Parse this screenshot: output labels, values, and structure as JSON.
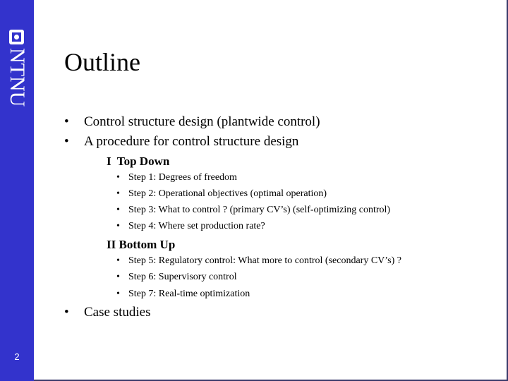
{
  "sidebar": {
    "logo_text": "NTNU",
    "page_number": "2",
    "color": "#3333cc"
  },
  "slide": {
    "title": "Outline",
    "bullet_glyph": "•",
    "items": [
      {
        "text": "Control structure design (plantwide control)"
      },
      {
        "text": "A procedure for control structure design"
      }
    ],
    "sections": [
      {
        "heading": "I  Top Down",
        "steps": [
          "Step 1: Degrees of freedom",
          "Step 2: Operational objectives (optimal operation)",
          "Step 3: What to control ? (primary CV’s) (self-optimizing control)",
          "Step 4: Where set production rate?"
        ]
      },
      {
        "heading": "II Bottom Up",
        "steps": [
          "Step 5: Regulatory control: What more to control (secondary CV’s) ?",
          "Step 6: Supervisory control",
          "Step 7: Real-time optimization"
        ]
      }
    ],
    "final_item": "Case studies"
  }
}
